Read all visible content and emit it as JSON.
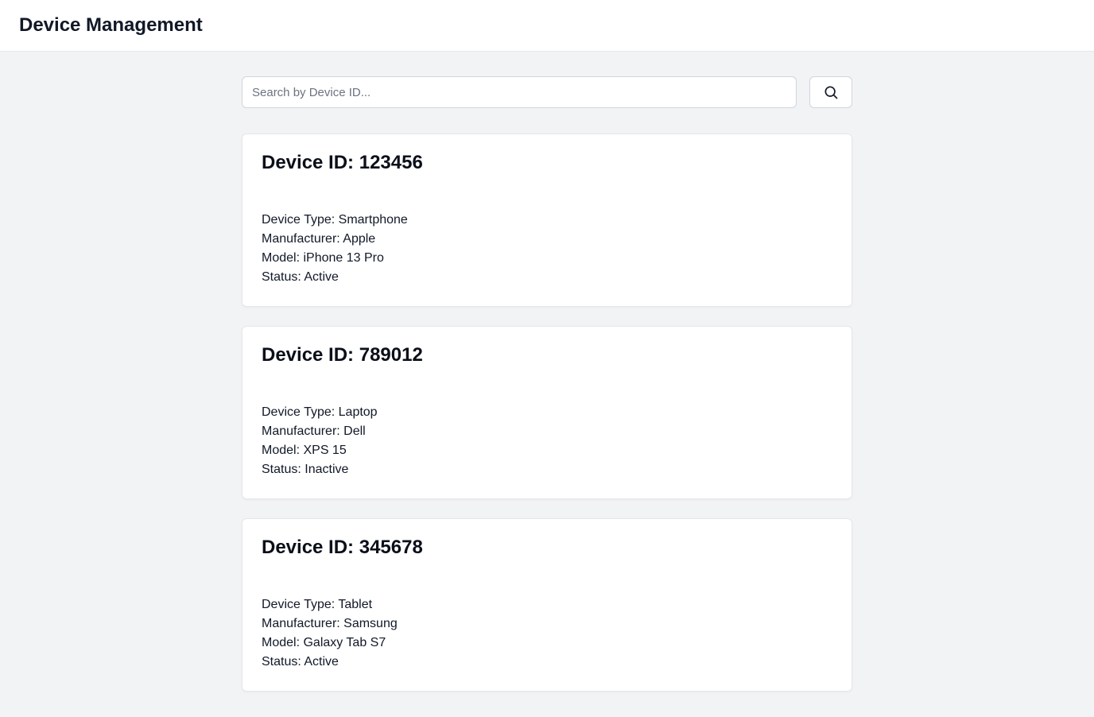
{
  "header": {
    "title": "Device Management"
  },
  "search": {
    "placeholder": "Search by Device ID...",
    "value": "",
    "button_icon": "search-icon"
  },
  "devices": [
    {
      "id_label": "Device ID: 123456",
      "type_label": "Device Type: Smartphone",
      "manufacturer_label": "Manufacturer: Apple",
      "model_label": "Model: iPhone 13 Pro",
      "status_label": "Status: Active"
    },
    {
      "id_label": "Device ID: 789012",
      "type_label": "Device Type: Laptop",
      "manufacturer_label": "Manufacturer: Dell",
      "model_label": "Model: XPS 15",
      "status_label": "Status: Inactive"
    },
    {
      "id_label": "Device ID: 345678",
      "type_label": "Device Type: Tablet",
      "manufacturer_label": "Manufacturer: Samsung",
      "model_label": "Model: Galaxy Tab S7",
      "status_label": "Status: Active"
    }
  ],
  "colors": {
    "page_background": "#f2f3f5",
    "card_background": "#ffffff",
    "border": "#e5e7eb",
    "text": "#111827"
  }
}
